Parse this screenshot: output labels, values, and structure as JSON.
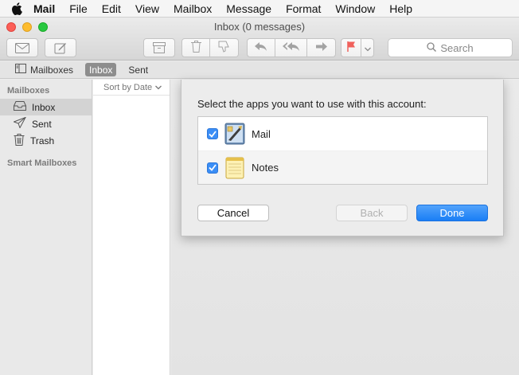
{
  "menubar": {
    "app_name": "Mail",
    "items": [
      "File",
      "Edit",
      "View",
      "Mailbox",
      "Message",
      "Format",
      "Window",
      "Help"
    ]
  },
  "window": {
    "title": "Inbox (0 messages)"
  },
  "toolbar": {
    "search_placeholder": "Search"
  },
  "favorites": {
    "mailboxes_label": "Mailboxes",
    "inbox_label": "Inbox",
    "sent_label": "Sent"
  },
  "sidebar": {
    "section_title": "Mailboxes",
    "items": [
      {
        "label": "Inbox",
        "icon": "inbox-tray-icon"
      },
      {
        "label": "Sent",
        "icon": "paper-plane-icon"
      },
      {
        "label": "Trash",
        "icon": "trash-icon"
      }
    ],
    "smart_section_title": "Smart Mailboxes"
  },
  "message_list": {
    "sort_label": "Sort by Date"
  },
  "dialog": {
    "prompt": "Select the apps you want to use with this account:",
    "apps": [
      {
        "name": "Mail",
        "checked": true,
        "icon": "mail-app-icon"
      },
      {
        "name": "Notes",
        "checked": true,
        "icon": "notes-app-icon"
      }
    ],
    "cancel_label": "Cancel",
    "back_label": "Back",
    "done_label": "Done"
  },
  "colors": {
    "accent": "#1a7ef5",
    "flag": "#f0615c"
  }
}
